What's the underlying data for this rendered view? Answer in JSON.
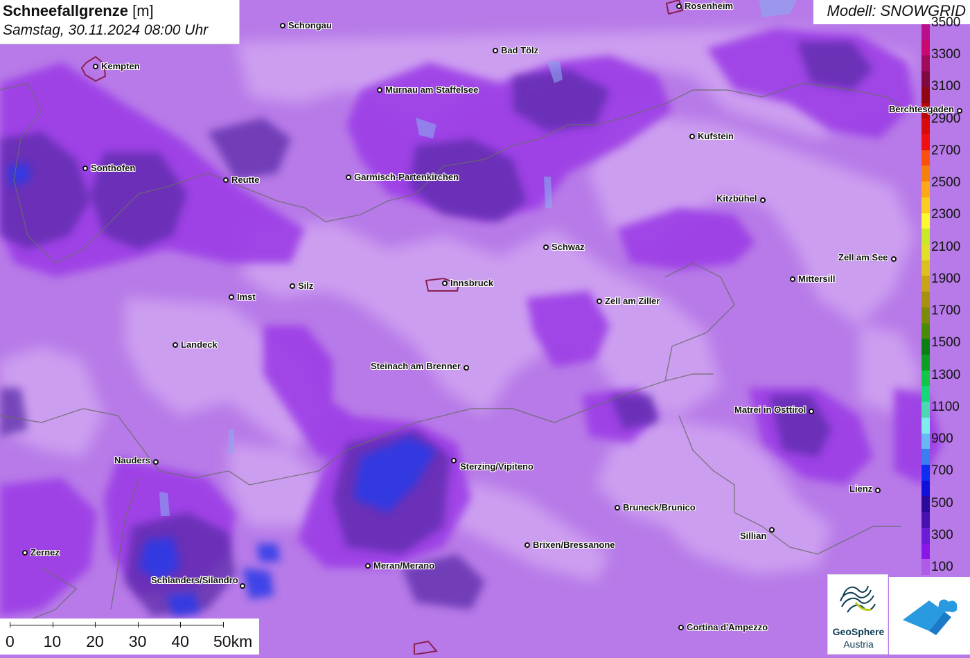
{
  "header": {
    "title_bold": "Schneefallgrenze",
    "title_unit": "[m]",
    "datetime": "Samstag, 30.11.2024 08:00 Uhr"
  },
  "model": {
    "label": "Modell: SNOWGRID"
  },
  "legend": {
    "labels": [
      "3300",
      "3100",
      "2900",
      "2700",
      "2500",
      "2300",
      "2100",
      "1900",
      "1700",
      "1500",
      "1300",
      "1100",
      "900",
      "700",
      "500",
      "300",
      "100"
    ],
    "top_label_partial": "3500",
    "colors": [
      "#b05ae8",
      "#8a16e8",
      "#6a1cd6",
      "#4a0fb0",
      "#2a0a9a",
      "#1010d8",
      "#0e2ef2",
      "#3a7ef0",
      "#68b8f4",
      "#7eecec",
      "#4ed8b0",
      "#16d878",
      "#12c648",
      "#0ca022",
      "#0a8010",
      "#4a8a08",
      "#7a8c0a",
      "#a89010",
      "#c8a418",
      "#dcc020",
      "#e0e028",
      "#c8e828",
      "#fafa30",
      "#fccc20",
      "#fca818",
      "#f48010",
      "#fa5010",
      "#f01010",
      "#d80a0a",
      "#b80808",
      "#900612",
      "#800a40",
      "#a00a5a",
      "#c80a70",
      "#b8108a"
    ]
  },
  "cities": [
    {
      "name": "Rosenheim"
    },
    {
      "name": "Schongau"
    },
    {
      "name": "Bad Tölz"
    },
    {
      "name": "Kempten"
    },
    {
      "name": "Murnau am Staffelsee"
    },
    {
      "name": "Berchtesgaden"
    },
    {
      "name": "Kufstein"
    },
    {
      "name": "Sonthofen"
    },
    {
      "name": "Reutte"
    },
    {
      "name": "Garmisch-Partenkirchen"
    },
    {
      "name": "Kitzbühel"
    },
    {
      "name": "Schwaz"
    },
    {
      "name": "Zell am See"
    },
    {
      "name": "Mittersill"
    },
    {
      "name": "Innsbruck"
    },
    {
      "name": "Silz"
    },
    {
      "name": "Imst"
    },
    {
      "name": "Zell am Ziller"
    },
    {
      "name": "Landeck"
    },
    {
      "name": "Steinach am Brenner"
    },
    {
      "name": "Matrei in Osttirol"
    },
    {
      "name": "Nauders"
    },
    {
      "name": "Sterzing/Vipiteno"
    },
    {
      "name": "Lienz"
    },
    {
      "name": "Bruneck/Brunico"
    },
    {
      "name": "Sillian"
    },
    {
      "name": "Brixen/Bressanone"
    },
    {
      "name": "Zernez"
    },
    {
      "name": "Meran/Merano"
    },
    {
      "name": "Schlanders/Silandro"
    },
    {
      "name": "Cortina d'Ampezzo"
    }
  ],
  "scalebar": {
    "labels": [
      "0",
      "10",
      "20",
      "30",
      "40",
      "50km"
    ]
  },
  "logos": {
    "geosphere_name": "GeoSphere",
    "geosphere_sub": "Austria"
  }
}
